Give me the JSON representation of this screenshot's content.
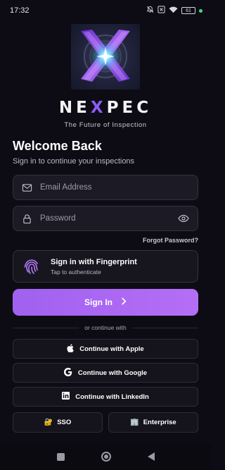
{
  "status_bar": {
    "time": "17:32",
    "battery": "61",
    "icons": [
      "mute-icon",
      "x-box-icon",
      "wifi-icon",
      "battery-icon",
      "dot-icon"
    ]
  },
  "brand": {
    "name_left": "NE",
    "name_x": "X",
    "name_right": "PEC",
    "tagline": "The Future of Inspection",
    "accent_color": "#8b5cf6"
  },
  "header": {
    "title": "Welcome Back",
    "subtitle": "Sign in to continue your inspections"
  },
  "form": {
    "email_placeholder": "Email Address",
    "password_placeholder": "Password",
    "forgot_label": "Forgot Password?"
  },
  "fingerprint": {
    "title": "Sign in with Fingerprint",
    "subtitle": "Tap to authenticate"
  },
  "signin": {
    "label": "Sign In",
    "color": "#a961f3"
  },
  "divider": {
    "text": "or continue with"
  },
  "social": {
    "apple_label": "Continue with Apple",
    "google_label": "Continue with Google",
    "linkedin_label": "Continue with LinkedIn",
    "sso_icon": "🔐",
    "sso_label": "SSO",
    "enterprise_icon": "🏢",
    "enterprise_label": "Enterprise"
  },
  "nav_bar": {
    "icons": [
      "recents-icon",
      "home-icon",
      "back-icon"
    ]
  }
}
